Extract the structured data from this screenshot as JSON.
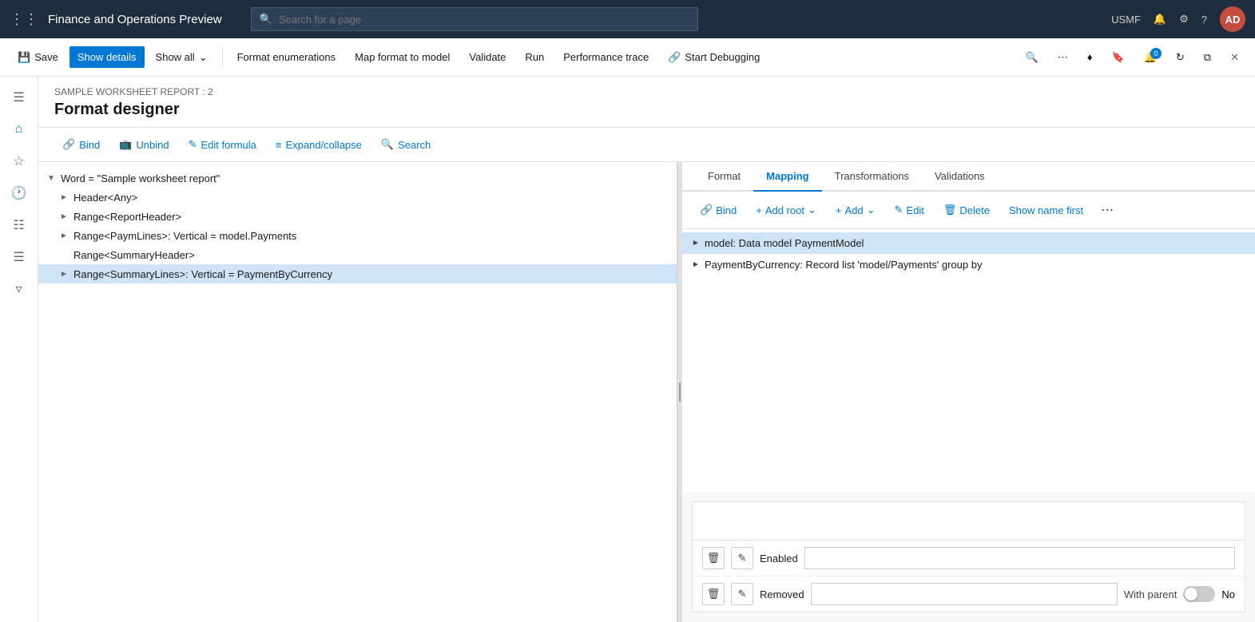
{
  "topNav": {
    "appTitle": "Finance and Operations Preview",
    "searchPlaceholder": "Search for a page",
    "userInitials": "AD",
    "orgCode": "USMF"
  },
  "commandBar": {
    "saveLabel": "Save",
    "showDetailsLabel": "Show details",
    "showAllLabel": "Show all",
    "formatEnumerationsLabel": "Format enumerations",
    "mapFormatToModelLabel": "Map format to model",
    "validateLabel": "Validate",
    "runLabel": "Run",
    "performanceTraceLabel": "Performance trace",
    "startDebuggingLabel": "Start Debugging"
  },
  "page": {
    "breadcrumb": "SAMPLE WORKSHEET REPORT : 2",
    "title": "Format designer"
  },
  "formatToolbar": {
    "bindLabel": "Bind",
    "unbindLabel": "Unbind",
    "editFormulaLabel": "Edit formula",
    "expandCollapseLabel": "Expand/collapse",
    "searchLabel": "Search"
  },
  "tree": {
    "items": [
      {
        "id": "word",
        "text": "Word = \"Sample worksheet report\"",
        "indent": 0,
        "expanded": true,
        "selected": false
      },
      {
        "id": "header",
        "text": "Header<Any>",
        "indent": 1,
        "expanded": false,
        "selected": false
      },
      {
        "id": "reportheader",
        "text": "Range<ReportHeader>",
        "indent": 1,
        "expanded": false,
        "selected": false
      },
      {
        "id": "paymlines",
        "text": "Range<PaymLines>: Vertical = model.Payments",
        "indent": 1,
        "expanded": false,
        "selected": false
      },
      {
        "id": "summaryheader",
        "text": "Range<SummaryHeader>",
        "indent": 1,
        "expanded": false,
        "selected": false
      },
      {
        "id": "summarylines",
        "text": "Range<SummaryLines>: Vertical = PaymentByCurrency",
        "indent": 1,
        "expanded": false,
        "selected": true
      }
    ]
  },
  "mapping": {
    "tabs": [
      {
        "id": "format",
        "label": "Format"
      },
      {
        "id": "mapping",
        "label": "Mapping",
        "active": true
      },
      {
        "id": "transformations",
        "label": "Transformations"
      },
      {
        "id": "validations",
        "label": "Validations"
      }
    ],
    "toolbar": {
      "bindLabel": "Bind",
      "addRootLabel": "Add root",
      "addLabel": "Add",
      "editLabel": "Edit",
      "deleteLabel": "Delete",
      "showNameFirstLabel": "Show name first"
    },
    "items": [
      {
        "id": "model",
        "text": "model: Data model PaymentModel",
        "indent": 0,
        "selected": true
      },
      {
        "id": "paymentbycurrency",
        "text": "PaymentByCurrency: Record list 'model/Payments' group by",
        "indent": 0,
        "selected": false
      }
    ]
  },
  "bottom": {
    "enabledLabel": "Enabled",
    "removedLabel": "Removed",
    "withParentLabel": "With parent",
    "toggleLabel": "No"
  }
}
